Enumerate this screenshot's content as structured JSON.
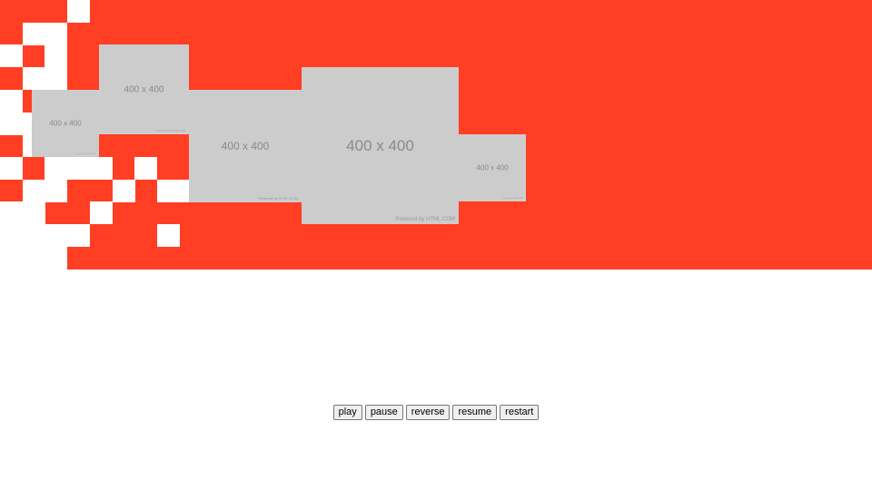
{
  "colors": {
    "accent": "#ff3e23",
    "placeholder_bg": "#cccccc",
    "page_bg": "#ffffff"
  },
  "placeholders": [
    {
      "label": "400 x 400",
      "credit": "Powered by HTML.COM"
    },
    {
      "label": "400 x 400",
      "credit": "Powered by HTML.COM"
    },
    {
      "label": "400 x 400",
      "credit": "Powered by HTML.COM"
    },
    {
      "label": "400 x 400",
      "credit": "Powered by HTML.COM"
    },
    {
      "label": "400 x 400",
      "credit": "Powered by HTML.COM"
    }
  ],
  "controls": {
    "play_label": "play",
    "pause_label": "pause",
    "reverse_label": "reverse",
    "resume_label": "resume",
    "restart_label": "restart"
  }
}
